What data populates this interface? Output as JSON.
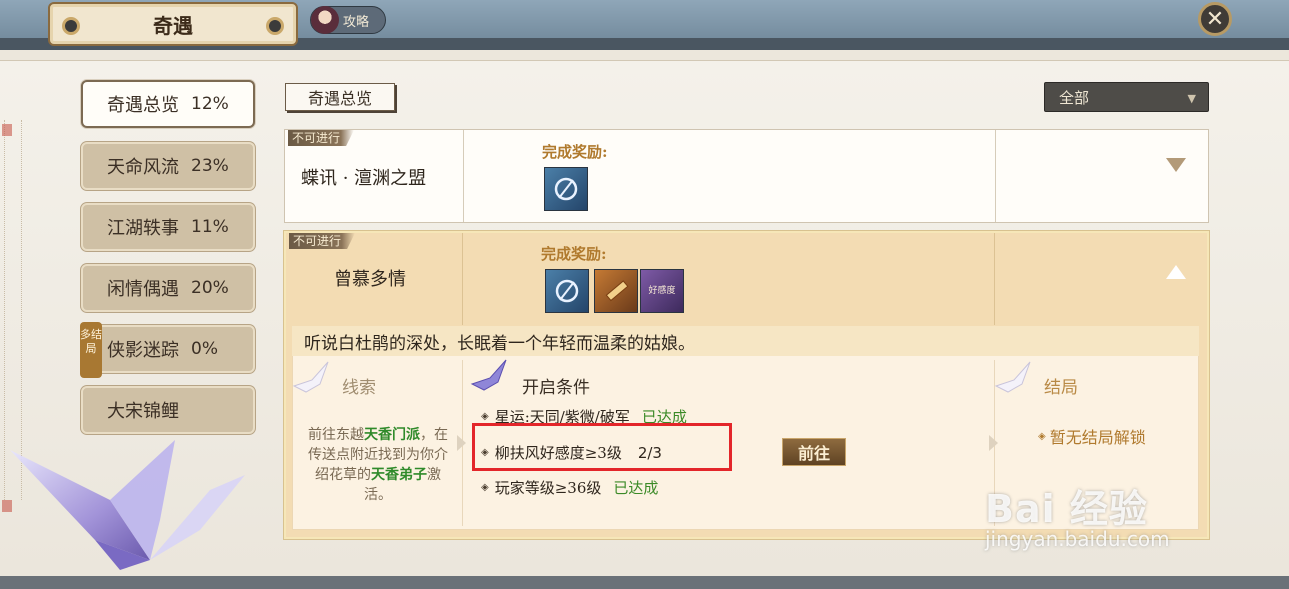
{
  "header": {
    "title": "奇遇",
    "guide_label": "攻略",
    "close_glyph": "✕"
  },
  "sidebar": {
    "items": [
      {
        "label": "奇遇总览",
        "pct": "12%",
        "active": true
      },
      {
        "label": "天命风流",
        "pct": "23%"
      },
      {
        "label": "江湖轶事",
        "pct": "11%"
      },
      {
        "label": "闲情偶遇",
        "pct": "20%"
      },
      {
        "label": "侠影迷踪",
        "pct": "0%",
        "badge": "多结局"
      },
      {
        "label": "大宋锦鲤",
        "pct": ""
      }
    ]
  },
  "main": {
    "overview_label": "奇遇总览",
    "filter": {
      "selected": "全部",
      "caret": "▼"
    },
    "quests": [
      {
        "status": "不可进行",
        "name": "蝶讯 · 澶渊之盟",
        "reward_label": "完成奖励:",
        "rewards": [
          "blue-swirl-icon"
        ],
        "expanded": false
      },
      {
        "status": "不可进行",
        "name": "曾慕多情",
        "reward_label": "完成奖励:",
        "rewards": [
          "blue-swirl-icon",
          "scroll-item-icon",
          "purple-badge-icon"
        ],
        "reward_badge_text": "好感度",
        "expanded": true,
        "description": "听说白杜鹃的深处，长眠着一个年轻而温柔的姑娘。",
        "clue": {
          "title": "线索",
          "text_1": "前往东越",
          "hl_1": "天香门派",
          "text_2": "，在传送点附近找到为你介绍花草的",
          "hl_2": "天香弟子",
          "text_3": "激活。"
        },
        "conditions": {
          "title": "开启条件",
          "items": [
            {
              "text": "星运:天同/紫微/破军",
              "status": "已达成"
            },
            {
              "text": "柳扶风好感度≥3级",
              "progress": "2/3"
            },
            {
              "text": "玩家等级≥36级",
              "status": "已达成"
            }
          ],
          "go_label": "前往"
        },
        "ending": {
          "title": "结局",
          "none_text": "暂无结局解锁"
        }
      }
    ]
  },
  "watermark": {
    "line1": "Bai 经验",
    "line2": "jingyan.baidu.com"
  },
  "colors": {
    "accent_gold": "#b07a2e",
    "done_green": "#3b8a27",
    "highlight_red": "#e3262a",
    "active_card": "#f3dcb3"
  }
}
